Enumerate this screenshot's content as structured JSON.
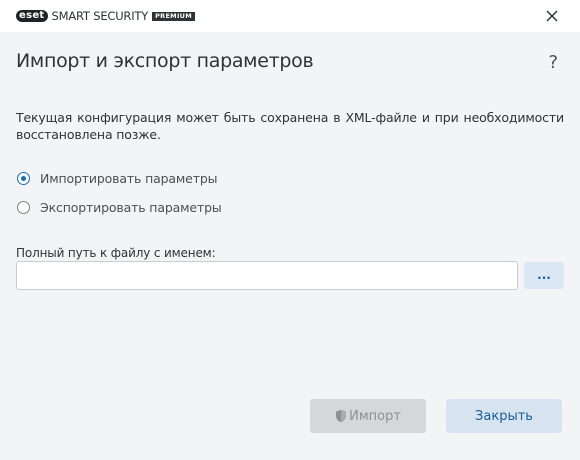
{
  "titlebar": {
    "logo_text": "eset",
    "product_name": "SMART SECURITY",
    "edition": "PREMIUM",
    "close_icon": "close-icon"
  },
  "dialog": {
    "title": "Импорт и экспорт параметров",
    "help_label": "?",
    "description": "Текущая конфигурация может быть сохранена в XML-файле и при необходимости восстановлена позже.",
    "options": [
      {
        "label": "Импортировать параметры",
        "selected": true
      },
      {
        "label": "Экспортировать параметры",
        "selected": false
      }
    ],
    "path_label": "Полный путь к файлу с именем:",
    "path_value": "",
    "browse_label": "...",
    "import_label": "Импорт",
    "import_icon": "shield-icon",
    "close_label": "Закрыть"
  },
  "colors": {
    "accent": "#1a6fb3",
    "background": "#f3f4f5",
    "secondary_button": "#d7e4f0",
    "disabled_button": "#d5d8db"
  }
}
